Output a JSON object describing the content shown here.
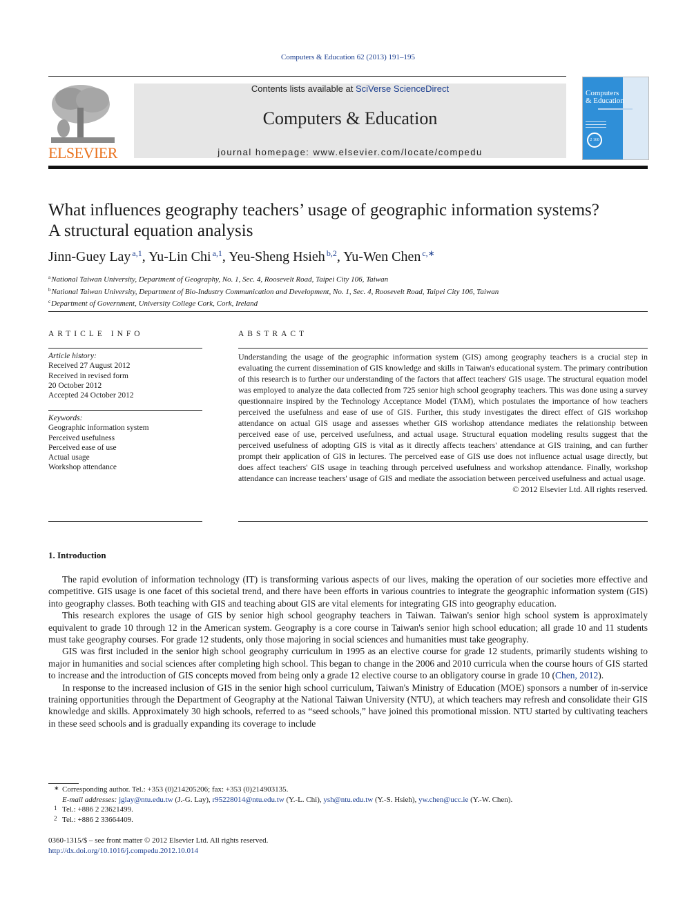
{
  "citation": "Computers & Education 62 (2013) 191–195",
  "masthead": {
    "contents_prefix": "Contents lists available at ",
    "contents_link": "SciVerse ScienceDirect",
    "journal_title": "Computers & Education",
    "homepage": "journal homepage: www.elsevier.com/locate/compedu",
    "publisher_logo": "ELSEVIER",
    "cover_title_line1": "Computers",
    "cover_title_line2": "& Education",
    "cover_seal": "2 160"
  },
  "article": {
    "title_line1": "What influences geography teachers’ usage of geographic information systems?",
    "title_line2": "A structural equation analysis",
    "authors": [
      {
        "name": "Jinn-Guey Lay",
        "sup": "a,1",
        "sep": ", "
      },
      {
        "name": "Yu-Lin Chi",
        "sup": "a,1",
        "sep": ", "
      },
      {
        "name": "Yeu-Sheng Hsieh",
        "sup": "b,2",
        "sep": ", "
      },
      {
        "name": "Yu-Wen Chen",
        "sup": "c,∗",
        "sep": ""
      }
    ],
    "affiliations": [
      {
        "mark": "a",
        "text": "National Taiwan University, Department of Geography, No. 1, Sec. 4, Roosevelt Road, Taipei City 106, Taiwan"
      },
      {
        "mark": "b",
        "text": "National Taiwan University, Department of Bio-Industry Communication and Development, No. 1, Sec. 4, Roosevelt Road, Taipei City 106, Taiwan"
      },
      {
        "mark": "c",
        "text": "Department of Government, University College Cork, Cork, Ireland"
      }
    ]
  },
  "article_info": {
    "heading": "ARTICLE INFO",
    "history_label": "Article history:",
    "history": [
      "Received 27 August 2012",
      "Received in revised form",
      "20 October 2012",
      "Accepted 24 October 2012"
    ],
    "keywords_label": "Keywords:",
    "keywords": [
      "Geographic information system",
      "Perceived usefulness",
      "Perceived ease of use",
      "Actual usage",
      "Workshop attendance"
    ]
  },
  "abstract": {
    "heading": "ABSTRACT",
    "text": "Understanding the usage of the geographic information system (GIS) among geography teachers is a crucial step in evaluating the current dissemination of GIS knowledge and skills in Taiwan's educational system. The primary contribution of this research is to further our understanding of the factors that affect teachers' GIS usage. The structural equation model was employed to analyze the data collected from 725 senior high school geography teachers. This was done using a survey questionnaire inspired by the Technology Acceptance Model (TAM), which postulates the importance of how teachers perceived the usefulness and ease of use of GIS. Further, this study investigates the direct effect of GIS workshop attendance on actual GIS usage and assesses whether GIS workshop attendance mediates the relationship between perceived ease of use, perceived usefulness, and actual usage. Structural equation modeling results suggest that the perceived usefulness of adopting GIS is vital as it directly affects teachers' attendance at GIS training, and can further prompt their application of GIS in lectures. The perceived ease of GIS use does not influence actual usage directly, but does affect teachers' GIS usage in teaching through perceived usefulness and workshop attendance. Finally, workshop attendance can increase teachers' usage of GIS and mediate the association between perceived usefulness and actual usage.",
    "copyright": "© 2012 Elsevier Ltd. All rights reserved."
  },
  "introduction": {
    "heading": "1.  Introduction",
    "paragraphs": [
      "The rapid evolution of information technology (IT) is transforming various aspects of our lives, making the operation of our societies more effective and competitive. GIS usage is one facet of this societal trend, and there have been efforts in various countries to integrate the geographic information system (GIS) into geography classes. Both teaching with GIS and teaching about GIS are vital elements for integrating GIS into geography education.",
      "This research explores the usage of GIS by senior high school geography teachers in Taiwan. Taiwan's senior high school system is approximately equivalent to grade 10 through 12 in the American system. Geography is a core course in Taiwan's senior high school education; all grade 10 and 11 students must take geography courses. For grade 12 students, only those majoring in social sciences and humanities must take geography.",
      "In response to the increased inclusion of GIS in the senior high school curriculum, Taiwan's Ministry of Education (MOE) sponsors a number of in-service training opportunities through the Department of Geography at the National Taiwan University (NTU), at which teachers may refresh and consolidate their GIS knowledge and skills. Approximately 30 high schools, referred to as “seed schools,” have joined this promotional mission. NTU started by cultivating teachers in these seed schools and is gradually expanding its coverage to include"
    ],
    "para3_before": "GIS was first included in the senior high school geography curriculum in 1995 as an elective course for grade 12 students, primarily students wishing to major in humanities and social sciences after completing high school. This began to change in the 2006 and 2010 curricula when the course hours of GIS started to increase and the introduction of GIS concepts moved from being only a grade 12 elective course to an obligatory course in grade 10 (",
    "para3_ref": "Chen, 2012",
    "para3_after": ")."
  },
  "footnotes": {
    "corresponding_mark": "∗",
    "corresponding": "Corresponding author. Tel.: +353 (0)214205206; fax: +353 (0)214903135.",
    "email_label": "E-mail addresses:",
    "emails": [
      {
        "email": "jglay@ntu.edu.tw",
        "who": " (J.-G. Lay), "
      },
      {
        "email": "r95228014@ntu.edu.tw",
        "who": " (Y.-L. Chi), "
      },
      {
        "email": "ysh@ntu.edu.tw",
        "who": " (Y.-S. Hsieh), "
      },
      {
        "email": "yw.chen@ucc.ie",
        "who": " (Y.-W. Chen)."
      }
    ],
    "fn1_mark": "1",
    "fn1": "Tel.: +886 2 23621499.",
    "fn2_mark": "2",
    "fn2": "Tel.: +886 2 33664409."
  },
  "footer": {
    "issn": "0360-1315/$ – see front matter © 2012 Elsevier Ltd. All rights reserved.",
    "doi": "http://dx.doi.org/10.1016/j.compedu.2012.10.014"
  }
}
